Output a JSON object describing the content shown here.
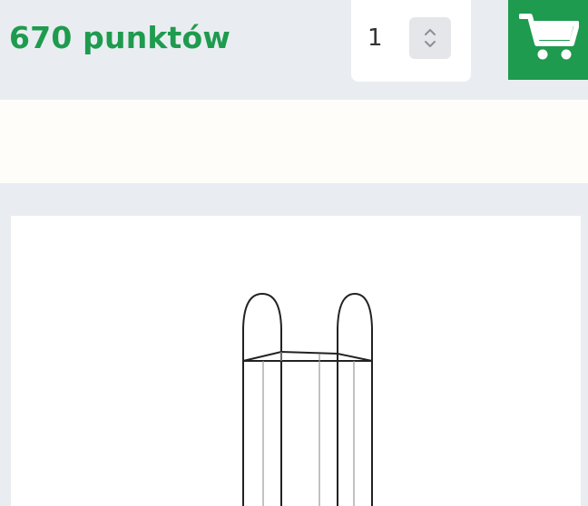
{
  "product": {
    "points_label": "670 punktów"
  },
  "quantity": {
    "value": "1"
  },
  "icons": {
    "stepper": "chevron-up-down-icon",
    "cart": "shopping-cart-icon"
  },
  "colors": {
    "accent_green": "#1e9b4e",
    "page_background": "#e9edf1",
    "notice_background": "#fffdf9"
  }
}
